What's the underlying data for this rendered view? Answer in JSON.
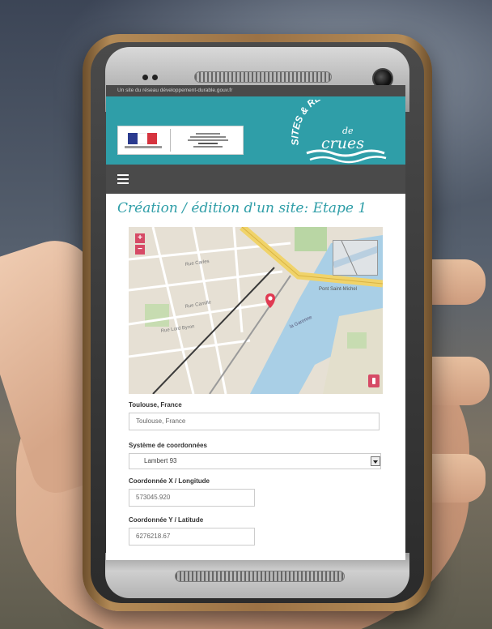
{
  "browser": {
    "top_bar_text": "Un site du réseau développement-durable.gouv.fr"
  },
  "header": {
    "gov_logo_text": "MINISTÈRE DE LA TRANSITION ÉCOLOGIQUE",
    "site_logo_line1": "SITES & REPÈRES",
    "site_logo_line2": "de",
    "site_logo_line3": "crues"
  },
  "page": {
    "title": "Création / édition d'un site: Etape 1"
  },
  "map": {
    "zoom_in": "+",
    "zoom_out": "−",
    "labels": [
      "Rue Carles",
      "Rue Camille",
      "Pont Saint-Michel",
      "la Garonne",
      "Rue Lord Byron"
    ]
  },
  "form": {
    "location_label": "Toulouse, France",
    "location_value": "Toulouse, France",
    "coord_system_label": "Système de coordonnées",
    "coord_system_value": "Lambert 93",
    "x_label": "Coordonnée X / Longitude",
    "x_value": "573045.920",
    "y_label": "Coordonnée Y / Latitude",
    "y_value": "6276218.67"
  },
  "colors": {
    "accent": "#2f9ea8",
    "nav": "#4a4a4a",
    "map_button": "#d64a66",
    "marker": "#e03a52"
  }
}
